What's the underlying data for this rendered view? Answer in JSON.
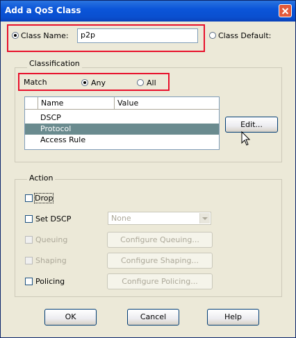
{
  "window": {
    "title": "Add a QoS Class"
  },
  "class_name": {
    "label": "Class Name:",
    "value": "p2p",
    "selected": true
  },
  "class_default": {
    "label": "Class Default:",
    "selected": false
  },
  "classification": {
    "group_label": "Classification",
    "match_label": "Match",
    "options": [
      {
        "label": "Any",
        "selected": true
      },
      {
        "label": "All",
        "selected": false
      }
    ],
    "table": {
      "columns": [
        "Name",
        "Value"
      ],
      "rows": [
        {
          "name": "DSCP",
          "value": "",
          "selected": false
        },
        {
          "name": "Protocol",
          "value": "",
          "selected": true
        },
        {
          "name": "Access Rule",
          "value": "",
          "selected": false
        }
      ]
    },
    "edit_button": "Edit..."
  },
  "action": {
    "group_label": "Action",
    "drop": "Drop",
    "set_dscp": "Set DSCP",
    "dscp_select": "None",
    "queuing": "Queuing",
    "configure_queuing": "Configure Queuing...",
    "shaping": "Shaping",
    "configure_shaping": "Configure Shaping...",
    "policing": "Policing",
    "configure_policing": "Configure Policing..."
  },
  "buttons": {
    "ok": "OK",
    "cancel": "Cancel",
    "help": "Help"
  },
  "colors": {
    "titlebar": "#0b55d9",
    "selection": "#6a8b8f",
    "highlight_box": "#e8102b"
  }
}
